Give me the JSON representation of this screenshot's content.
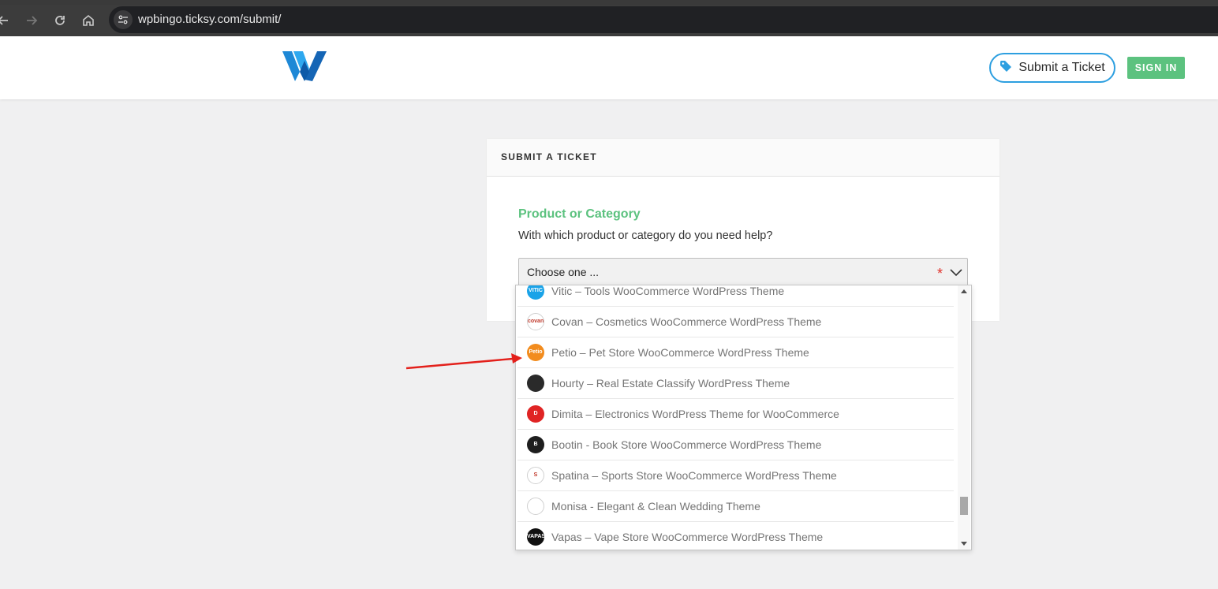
{
  "browser": {
    "url": "wpbingo.ticksy.com/submit/"
  },
  "header": {
    "submit_ticket_label": "Submit a Ticket",
    "signin_label": "SIGN IN",
    "accent_color": "#2d9fe0",
    "signin_color": "#5cc27f"
  },
  "card": {
    "title": "SUBMIT A TICKET",
    "field_title": "Product or Category",
    "field_help": "With which product or category do you need help?",
    "select_value": "Choose one ...",
    "required_mark": "*"
  },
  "dropdown": {
    "items": [
      {
        "label": "Vitic – Tools WooCommerce WordPress Theme",
        "icon": "vitic-logo-icon",
        "icon_text": "VITIC",
        "icon_color": "#1aa3e8"
      },
      {
        "label": "Covan – Cosmetics WooCommerce WordPress Theme",
        "icon": "covan-logo-icon",
        "icon_text": "covan",
        "icon_color": "#ffffff"
      },
      {
        "label": "Petio – Pet Store WooCommerce WordPress Theme",
        "icon": "petio-logo-icon",
        "icon_text": "Petio",
        "icon_color": "#f28c1e"
      },
      {
        "label": "Hourty – Real Estate Classify WordPress Theme",
        "icon": "hourty-logo-icon",
        "icon_text": "",
        "icon_color": "#2a2a2a"
      },
      {
        "label": "Dimita – Electronics WordPress Theme for WooCommerce",
        "icon": "dimita-logo-icon",
        "icon_text": "D",
        "icon_color": "#e02424"
      },
      {
        "label": "Bootin - Book Store WooCommerce WordPress Theme",
        "icon": "bootin-logo-icon",
        "icon_text": "B",
        "icon_color": "#1e1e1e"
      },
      {
        "label": "Spatina – Sports Store WooCommerce WordPress Theme",
        "icon": "spatina-logo-icon",
        "icon_text": "S",
        "icon_color": "#ffffff"
      },
      {
        "label": "Monisa - Elegant & Clean Wedding Theme",
        "icon": "monisa-logo-icon",
        "icon_text": "",
        "icon_color": "#ffffff"
      },
      {
        "label": "Vapas – Vape Store WooCommerce WordPress Theme",
        "icon": "vapas-logo-icon",
        "icon_text": "VAPAS",
        "icon_color": "#111111"
      }
    ]
  }
}
